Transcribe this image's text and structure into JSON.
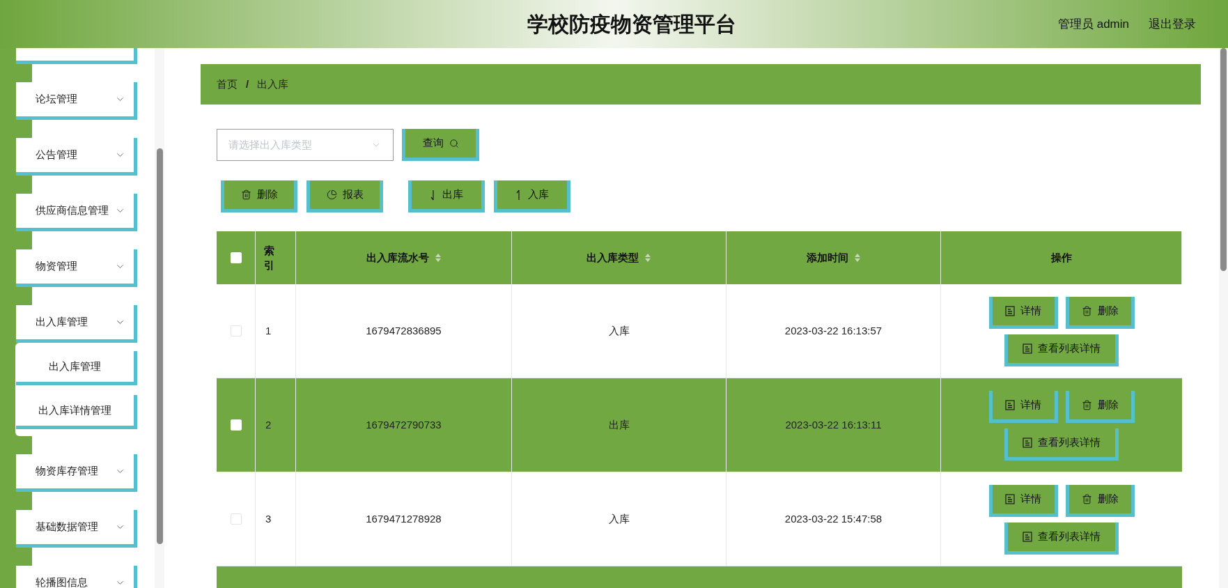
{
  "header": {
    "title": "学校防疫物资管理平台",
    "user": "管理员 admin",
    "logout": "退出登录"
  },
  "sidebar": {
    "items": [
      {
        "label": "论坛管理",
        "expanded": false
      },
      {
        "label": "公告管理",
        "expanded": false
      },
      {
        "label": "供应商信息管理",
        "expanded": false
      },
      {
        "label": "物资管理",
        "expanded": false
      },
      {
        "label": "出入库管理",
        "expanded": true,
        "children": [
          {
            "label": "出入库管理"
          },
          {
            "label": "出入库详情管理"
          }
        ]
      },
      {
        "label": "物资库存管理",
        "expanded": false
      },
      {
        "label": "基础数据管理",
        "expanded": false
      },
      {
        "label": "轮播图信息",
        "expanded": false
      }
    ]
  },
  "breadcrumb": {
    "separator": "/",
    "items": [
      "首页",
      "出入库"
    ]
  },
  "filter": {
    "placeholder": "请选择出入库类型",
    "search_button": "查询"
  },
  "toolbar": [
    {
      "kind": "delete",
      "label": "删除"
    },
    {
      "kind": "report",
      "label": "报表"
    },
    {
      "kind": "out",
      "label": "出库"
    },
    {
      "kind": "in",
      "label": "入库"
    }
  ],
  "table": {
    "header_checked": false,
    "columns": [
      {
        "label": "索引",
        "sortable": false
      },
      {
        "label": "出入库流水号",
        "sortable": true
      },
      {
        "label": "出入库类型",
        "sortable": true
      },
      {
        "label": "添加时间",
        "sortable": true
      },
      {
        "label": "操作",
        "sortable": false
      }
    ],
    "rows": [
      {
        "checked": false,
        "index": "1",
        "serial": "1679472836895",
        "type": "入库",
        "time": "2023-03-22 16:13:57",
        "actions": [
          {
            "kind": "detail",
            "label": "详情"
          },
          {
            "kind": "delete",
            "label": "删除"
          },
          {
            "kind": "detail",
            "label": "查看列表详情"
          }
        ]
      },
      {
        "checked": false,
        "index": "2",
        "serial": "1679472790733",
        "type": "出库",
        "time": "2023-03-22 16:13:11",
        "actions": [
          {
            "kind": "detail",
            "label": "详情"
          },
          {
            "kind": "delete",
            "label": "删除"
          },
          {
            "kind": "detail",
            "label": "查看列表详情"
          }
        ]
      },
      {
        "checked": false,
        "index": "3",
        "serial": "1679471278928",
        "type": "入库",
        "time": "2023-03-22 15:47:58",
        "actions": [
          {
            "kind": "detail",
            "label": "详情"
          },
          {
            "kind": "delete",
            "label": "删除"
          },
          {
            "kind": "detail",
            "label": "查看列表详情"
          }
        ]
      }
    ]
  }
}
